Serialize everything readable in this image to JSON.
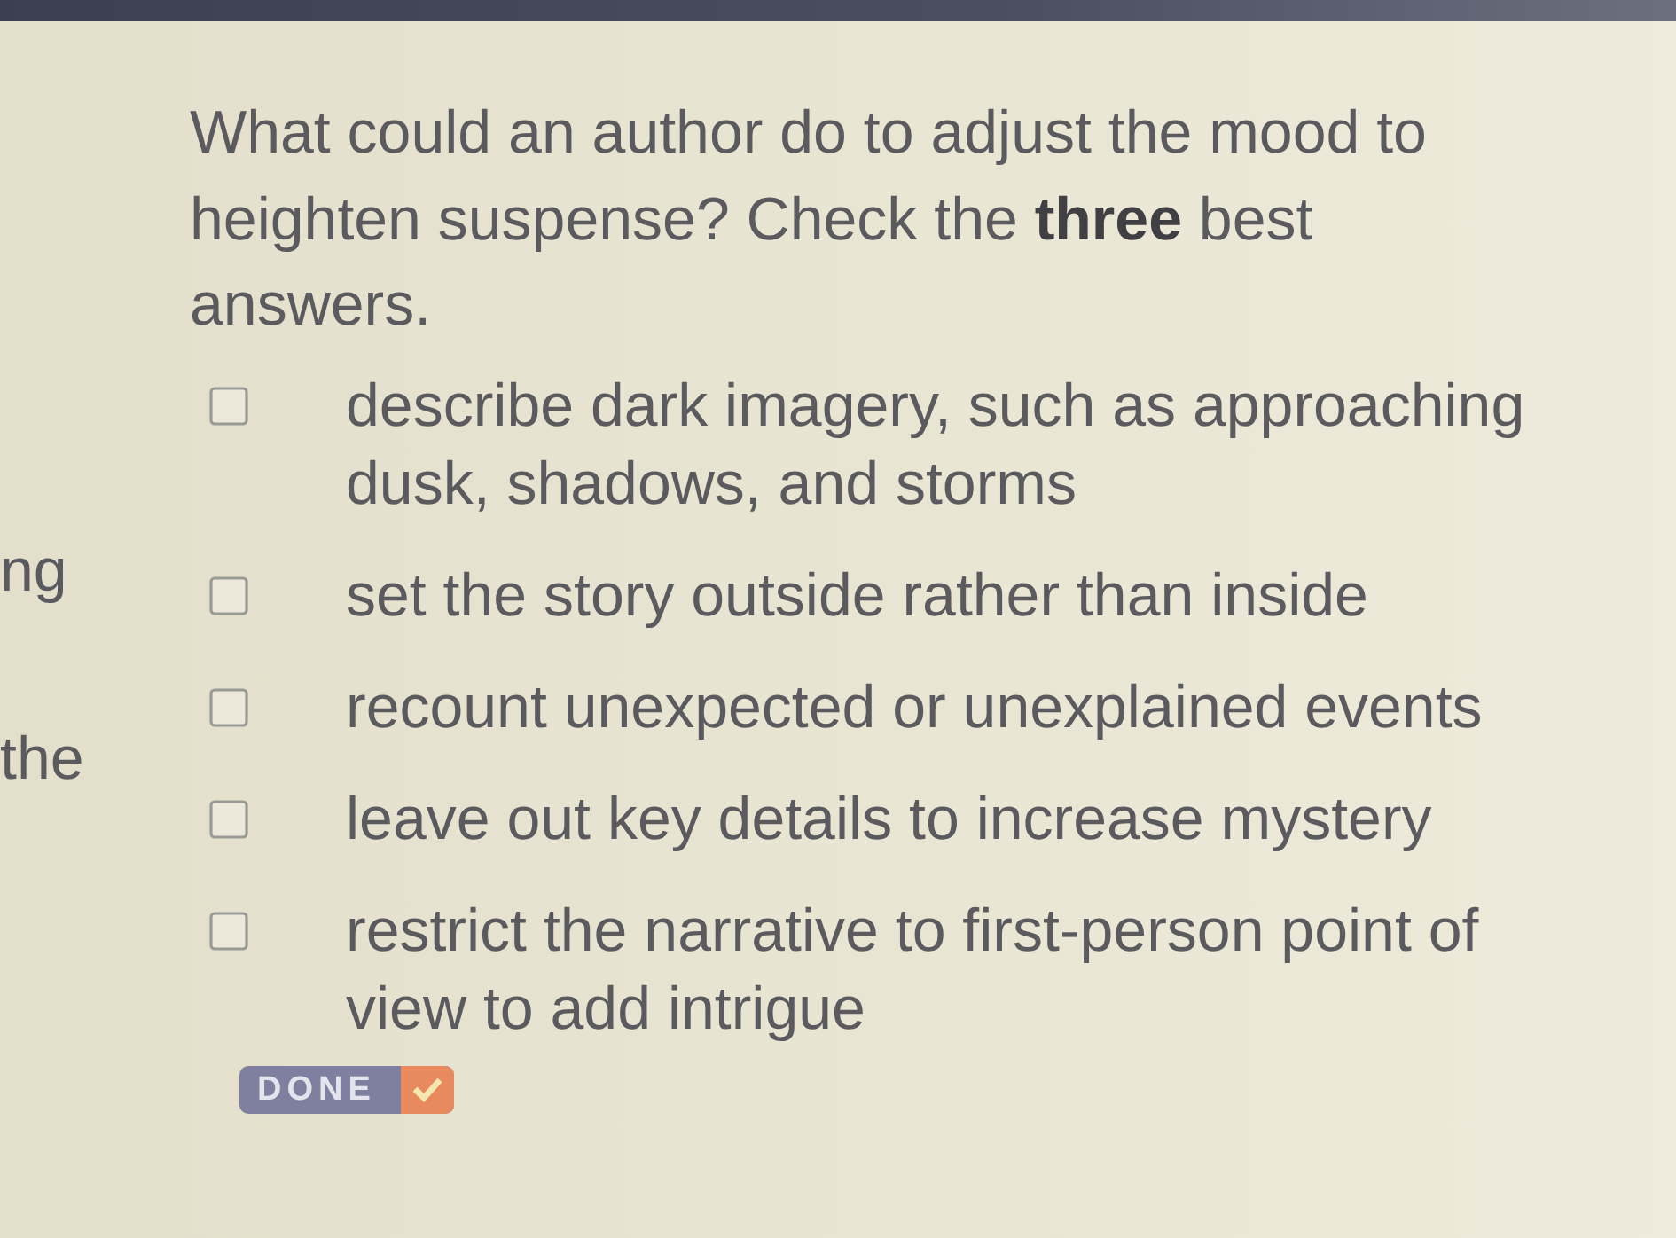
{
  "question": "What could an author do to adjust the mood to heighten suspense? Check the **three** best answers.",
  "passage_fragments": [
    "ng",
    "the"
  ],
  "options": [
    {
      "text": "describe dark imagery, such as approaching dusk, shadows, and storms",
      "checked": false
    },
    {
      "text": "set the story outside rather than inside",
      "checked": false
    },
    {
      "text": "recount unexpected or unexplained events",
      "checked": false
    },
    {
      "text": "leave out key details to increase mystery",
      "checked": false
    },
    {
      "text": "restrict the narrative to first-person point of view to add intrigue",
      "checked": false
    }
  ],
  "done_button": {
    "label": "DONE"
  }
}
